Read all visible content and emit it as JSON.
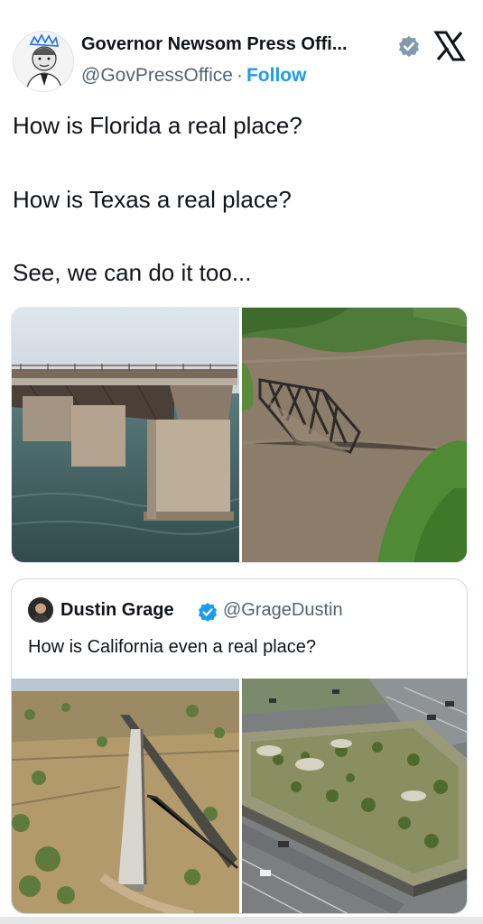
{
  "author": {
    "name": "Governor Newsom Press Offi...",
    "handle": "@GovPressOffice",
    "separator": "·",
    "follow_label": "Follow",
    "verified_icon": "verified-badge-icon",
    "platform_icon": "x-logo-icon"
  },
  "tweet": {
    "lines": [
      "How is Florida a real place?",
      "How is Texas a real place?",
      "See, we can do it too..."
    ],
    "media": [
      {
        "icon": "broken-bridge-photo"
      },
      {
        "icon": "flooded-bridge-photo"
      }
    ]
  },
  "quote": {
    "name": "Dustin Grage",
    "handle": "@GrageDustin",
    "text": "How is California even a real place?",
    "media": [
      {
        "icon": "dead-end-bridge-photo"
      },
      {
        "icon": "freeway-park-bridge-photo"
      }
    ]
  },
  "colors": {
    "accent": "#1d9bf0",
    "text": "#0f1419",
    "muted": "#536471",
    "verified": "#829aab"
  }
}
